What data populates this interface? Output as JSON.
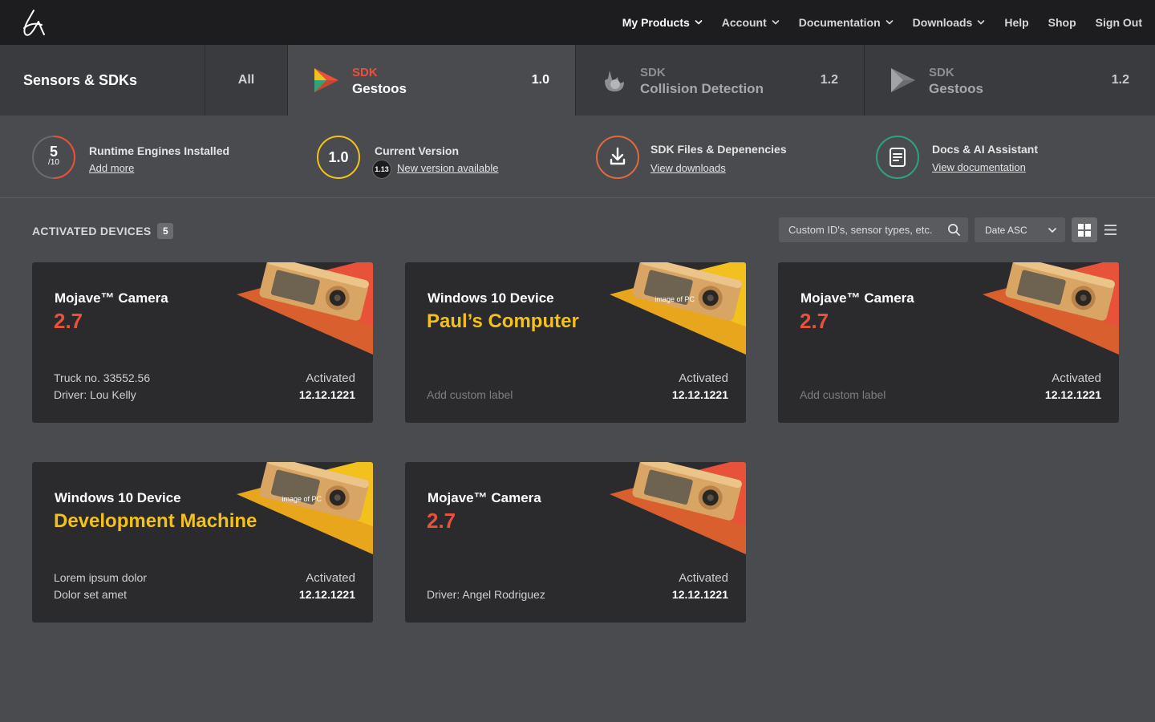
{
  "nav": {
    "items": [
      {
        "label": "My Products",
        "dropdown": true,
        "active": true
      },
      {
        "label": "Account",
        "dropdown": true
      },
      {
        "label": "Documentation",
        "dropdown": true
      },
      {
        "label": "Downloads",
        "dropdown": true
      },
      {
        "label": "Help",
        "dropdown": false
      },
      {
        "label": "Shop",
        "dropdown": false
      },
      {
        "label": "Sign Out",
        "dropdown": false
      }
    ]
  },
  "tabs": {
    "section_title": "Sensors & SDKs",
    "all_label": "All",
    "products": [
      {
        "kicker": "SDK",
        "name": "Gestoos",
        "version": "1.0",
        "active": true
      },
      {
        "kicker": "SDK",
        "name": "Collision Detection",
        "version": "1.2",
        "active": false
      },
      {
        "kicker": "SDK",
        "name": "Gestoos",
        "version": "1.2",
        "active": false
      }
    ]
  },
  "info": {
    "engines": {
      "count": "5",
      "total": "/10",
      "progress": 0.5,
      "title": "Runtime Engines Installed",
      "link": "Add more"
    },
    "version": {
      "value": "1.0",
      "new_badge": "1.13",
      "title": "Current Version",
      "link": "New version available"
    },
    "files": {
      "title": "SDK  Files & Depenencies",
      "link": "View downloads"
    },
    "docs": {
      "title": "Docs & AI Assistant",
      "link": "View documentation"
    },
    "colors": {
      "engines": "#e8513a",
      "version": "#f2c11d",
      "files": "#e06a3c",
      "docs": "#2fa37a"
    }
  },
  "devices": {
    "label": "ACTIVATED DEVICES",
    "count": "5",
    "search_placeholder": "Custom ID's, sensor types, etc.",
    "sort_label": "Date ASC",
    "cards": [
      {
        "type": "Mojave™ Camera",
        "name": "2.7",
        "accent": "orange",
        "meta": [
          "Truck no. 33552.56",
          "Driver: Lou Kelly"
        ],
        "placeholder": false,
        "act_label": "Activated",
        "act_date": "12.12.1221",
        "overlay": ""
      },
      {
        "type": "Windows 10 Device",
        "name": "Paul’s Computer",
        "accent": "yellow",
        "meta": [
          "Add custom label"
        ],
        "placeholder": true,
        "act_label": "Activated",
        "act_date": "12.12.1221",
        "overlay": "image of PC"
      },
      {
        "type": "Mojave™ Camera",
        "name": "2.7",
        "accent": "orange",
        "meta": [
          "Add custom label"
        ],
        "placeholder": true,
        "act_label": "Activated",
        "act_date": "12.12.1221",
        "overlay": ""
      },
      {
        "type": "Windows 10 Device",
        "name": "Development Machine",
        "accent": "yellow",
        "meta": [
          "Lorem ipsum dolor",
          "Dolor set amet"
        ],
        "placeholder": false,
        "act_label": "Activated",
        "act_date": "12.12.1221",
        "overlay": "image of PC"
      },
      {
        "type": "Mojave™ Camera",
        "name": "2.7",
        "accent": "orange",
        "meta": [
          "Driver: Angel Rodriguez"
        ],
        "placeholder": false,
        "act_label": "Activated",
        "act_date": "12.12.1221",
        "overlay": ""
      }
    ]
  }
}
